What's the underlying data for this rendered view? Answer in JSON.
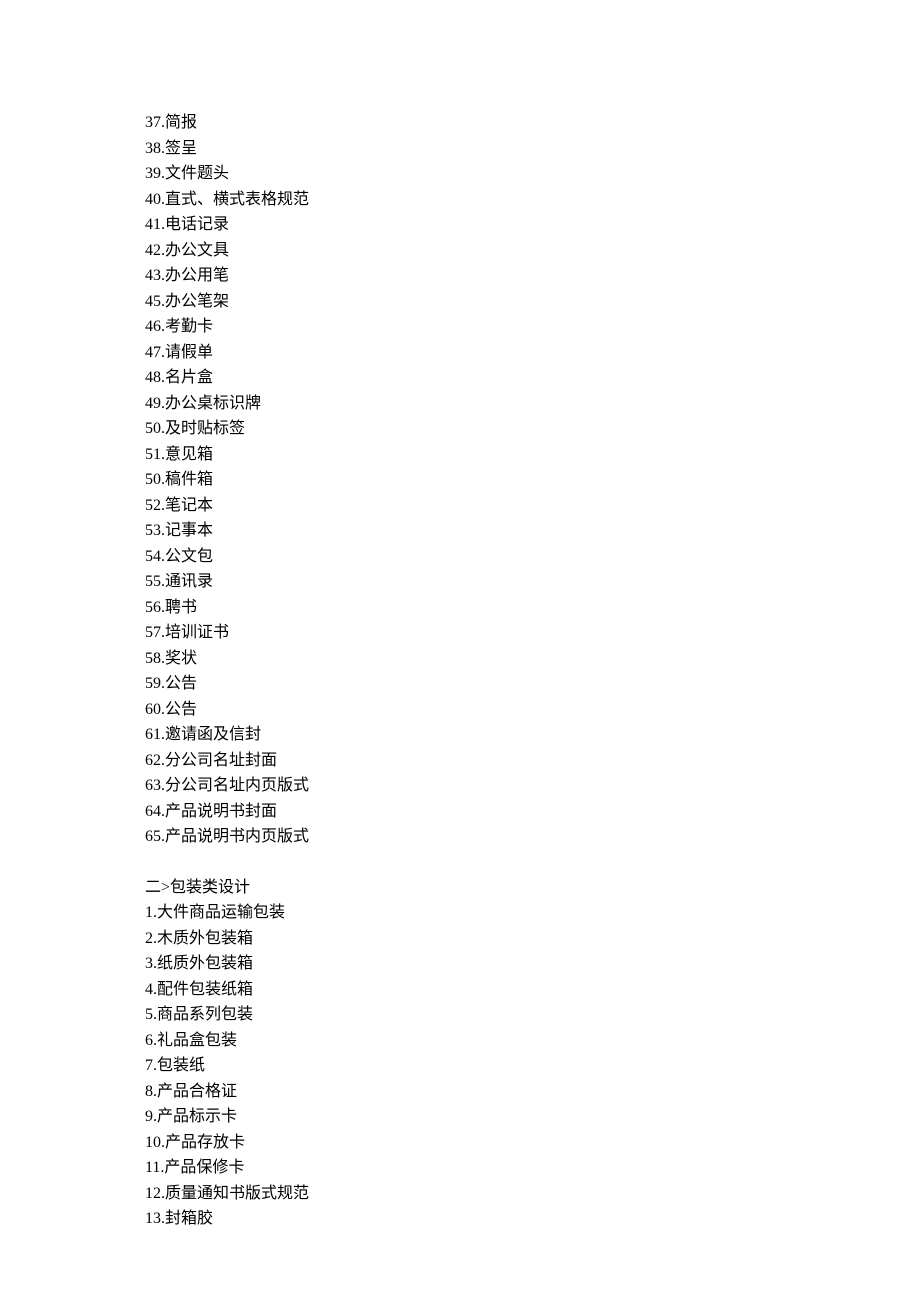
{
  "section1": {
    "items": [
      "37.简报",
      "38.签呈",
      "39.文件题头",
      "40.直式、横式表格规范",
      "41.电话记录",
      "42.办公文具",
      "43.办公用笔",
      "45.办公笔架",
      "46.考勤卡",
      "47.请假单",
      "48.名片盒",
      "49.办公桌标识牌",
      "50.及时贴标签",
      "51.意见箱",
      "50.稿件箱",
      "52.笔记本",
      "53.记事本",
      "54.公文包",
      "55.通讯录",
      "56.聘书",
      "57.培训证书",
      "58.奖状",
      "59.公告",
      "60.公告",
      "61.邀请函及信封",
      "62.分公司名址封面",
      "63.分公司名址内页版式",
      "64.产品说明书封面",
      "65.产品说明书内页版式"
    ]
  },
  "section2": {
    "heading": "二>包装类设计",
    "items": [
      "1.大件商品运输包装",
      "2.木质外包装箱",
      "3.纸质外包装箱",
      "4.配件包装纸箱",
      "5.商品系列包装",
      "6.礼品盒包装",
      "7.包装纸",
      "8.产品合格证",
      "9.产品标示卡",
      "10.产品存放卡",
      "11.产品保修卡",
      "12.质量通知书版式规范",
      "13.封箱胶"
    ]
  }
}
